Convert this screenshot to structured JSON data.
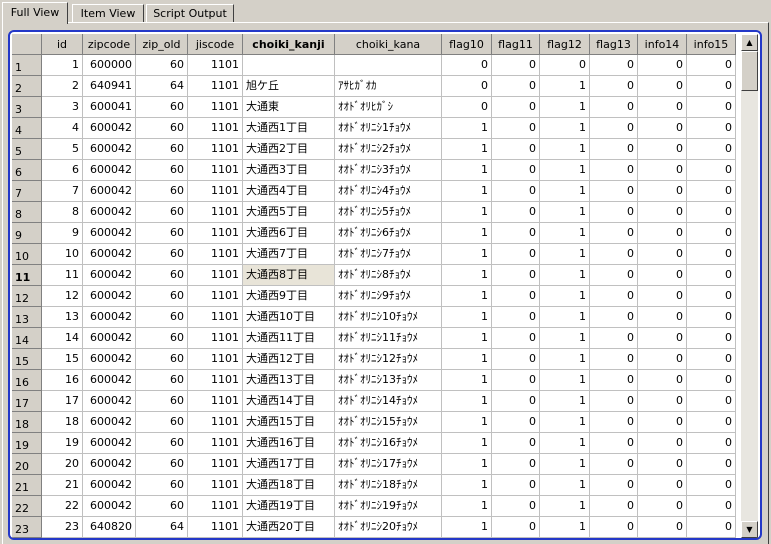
{
  "tabs": [
    {
      "label": "Full View",
      "active": true
    },
    {
      "label": "Item View",
      "active": false
    },
    {
      "label": "Script Output",
      "active": false
    }
  ],
  "grid": {
    "columns": [
      "id",
      "zipcode",
      "zip_old",
      "jiscode",
      "choiki_kanji",
      "choiki_kana",
      "flag10",
      "flag11",
      "flag12",
      "flag13",
      "info14",
      "info15"
    ],
    "sorted_column": "choiki_kanji",
    "current_row": 11,
    "rows": [
      [
        "1",
        "600000",
        "60",
        "1101",
        "",
        "",
        "0",
        "0",
        "0",
        "0",
        "0",
        "0"
      ],
      [
        "2",
        "640941",
        "64",
        "1101",
        "旭ケ丘",
        "ｱｻﾋｶﾞｵｶ",
        "0",
        "0",
        "1",
        "0",
        "0",
        "0"
      ],
      [
        "3",
        "600041",
        "60",
        "1101",
        "大通東",
        "ｵｵﾄﾞｵﾘﾋｶﾞｼ",
        "0",
        "0",
        "1",
        "0",
        "0",
        "0"
      ],
      [
        "4",
        "600042",
        "60",
        "1101",
        "大通西1丁目",
        "ｵｵﾄﾞｵﾘﾆｼ1ﾁｮｳﾒ",
        "1",
        "0",
        "1",
        "0",
        "0",
        "0"
      ],
      [
        "5",
        "600042",
        "60",
        "1101",
        "大通西2丁目",
        "ｵｵﾄﾞｵﾘﾆｼ2ﾁｮｳﾒ",
        "1",
        "0",
        "1",
        "0",
        "0",
        "0"
      ],
      [
        "6",
        "600042",
        "60",
        "1101",
        "大通西3丁目",
        "ｵｵﾄﾞｵﾘﾆｼ3ﾁｮｳﾒ",
        "1",
        "0",
        "1",
        "0",
        "0",
        "0"
      ],
      [
        "7",
        "600042",
        "60",
        "1101",
        "大通西4丁目",
        "ｵｵﾄﾞｵﾘﾆｼ4ﾁｮｳﾒ",
        "1",
        "0",
        "1",
        "0",
        "0",
        "0"
      ],
      [
        "8",
        "600042",
        "60",
        "1101",
        "大通西5丁目",
        "ｵｵﾄﾞｵﾘﾆｼ5ﾁｮｳﾒ",
        "1",
        "0",
        "1",
        "0",
        "0",
        "0"
      ],
      [
        "9",
        "600042",
        "60",
        "1101",
        "大通西6丁目",
        "ｵｵﾄﾞｵﾘﾆｼ6ﾁｮｳﾒ",
        "1",
        "0",
        "1",
        "0",
        "0",
        "0"
      ],
      [
        "10",
        "600042",
        "60",
        "1101",
        "大通西7丁目",
        "ｵｵﾄﾞｵﾘﾆｼ7ﾁｮｳﾒ",
        "1",
        "0",
        "1",
        "0",
        "0",
        "0"
      ],
      [
        "11",
        "600042",
        "60",
        "1101",
        "大通西8丁目",
        "ｵｵﾄﾞｵﾘﾆｼ8ﾁｮｳﾒ",
        "1",
        "0",
        "1",
        "0",
        "0",
        "0"
      ],
      [
        "12",
        "600042",
        "60",
        "1101",
        "大通西9丁目",
        "ｵｵﾄﾞｵﾘﾆｼ9ﾁｮｳﾒ",
        "1",
        "0",
        "1",
        "0",
        "0",
        "0"
      ],
      [
        "13",
        "600042",
        "60",
        "1101",
        "大通西10丁目",
        "ｵｵﾄﾞｵﾘﾆｼ10ﾁｮｳﾒ",
        "1",
        "0",
        "1",
        "0",
        "0",
        "0"
      ],
      [
        "14",
        "600042",
        "60",
        "1101",
        "大通西11丁目",
        "ｵｵﾄﾞｵﾘﾆｼ11ﾁｮｳﾒ",
        "1",
        "0",
        "1",
        "0",
        "0",
        "0"
      ],
      [
        "15",
        "600042",
        "60",
        "1101",
        "大通西12丁目",
        "ｵｵﾄﾞｵﾘﾆｼ12ﾁｮｳﾒ",
        "1",
        "0",
        "1",
        "0",
        "0",
        "0"
      ],
      [
        "16",
        "600042",
        "60",
        "1101",
        "大通西13丁目",
        "ｵｵﾄﾞｵﾘﾆｼ13ﾁｮｳﾒ",
        "1",
        "0",
        "1",
        "0",
        "0",
        "0"
      ],
      [
        "17",
        "600042",
        "60",
        "1101",
        "大通西14丁目",
        "ｵｵﾄﾞｵﾘﾆｼ14ﾁｮｳﾒ",
        "1",
        "0",
        "1",
        "0",
        "0",
        "0"
      ],
      [
        "18",
        "600042",
        "60",
        "1101",
        "大通西15丁目",
        "ｵｵﾄﾞｵﾘﾆｼ15ﾁｮｳﾒ",
        "1",
        "0",
        "1",
        "0",
        "0",
        "0"
      ],
      [
        "19",
        "600042",
        "60",
        "1101",
        "大通西16丁目",
        "ｵｵﾄﾞｵﾘﾆｼ16ﾁｮｳﾒ",
        "1",
        "0",
        "1",
        "0",
        "0",
        "0"
      ],
      [
        "20",
        "600042",
        "60",
        "1101",
        "大通西17丁目",
        "ｵｵﾄﾞｵﾘﾆｼ17ﾁｮｳﾒ",
        "1",
        "0",
        "1",
        "0",
        "0",
        "0"
      ],
      [
        "21",
        "600042",
        "60",
        "1101",
        "大通西18丁目",
        "ｵｵﾄﾞｵﾘﾆｼ18ﾁｮｳﾒ",
        "1",
        "0",
        "1",
        "0",
        "0",
        "0"
      ],
      [
        "22",
        "600042",
        "60",
        "1101",
        "大通西19丁目",
        "ｵｵﾄﾞｵﾘﾆｼ19ﾁｮｳﾒ",
        "1",
        "0",
        "1",
        "0",
        "0",
        "0"
      ],
      [
        "23",
        "640820",
        "64",
        "1101",
        "大通西20丁目",
        "ｵｵﾄﾞｵﾘﾆｼ20ﾁｮｳﾒ",
        "1",
        "0",
        "1",
        "0",
        "0",
        "0"
      ]
    ]
  },
  "scrollbar": {
    "up_icon": "arrow-up-icon",
    "down_icon": "arrow-down-icon"
  }
}
